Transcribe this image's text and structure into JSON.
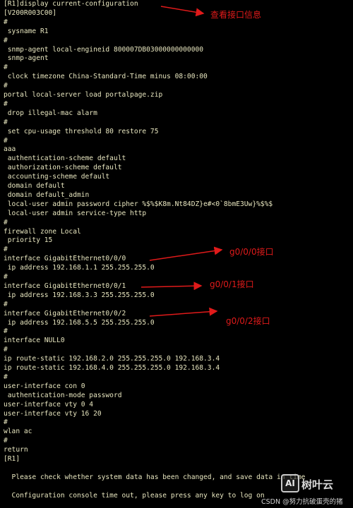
{
  "terminal": {
    "lines": [
      "[R1]display current-configuration",
      "[V200R003C00]",
      "#",
      " sysname R1",
      "#",
      " snmp-agent local-engineid 800007DB03000000000000",
      " snmp-agent",
      "#",
      " clock timezone China-Standard-Time minus 08:00:00",
      "#",
      "portal local-server load portalpage.zip",
      "#",
      " drop illegal-mac alarm",
      "#",
      " set cpu-usage threshold 80 restore 75",
      "#",
      "aaa",
      " authentication-scheme default",
      " authorization-scheme default",
      " accounting-scheme default",
      " domain default",
      " domain default_admin",
      " local-user admin password cipher %$%$K8m.Nt84DZ}e#<0`8bmE3Uw}%$%$",
      " local-user admin service-type http",
      "#",
      "firewall zone Local",
      " priority 15",
      "#",
      "interface GigabitEthernet0/0/0",
      " ip address 192.168.1.1 255.255.255.0",
      "#",
      "interface GigabitEthernet0/0/1",
      " ip address 192.168.3.3 255.255.255.0",
      "#",
      "interface GigabitEthernet0/0/2",
      " ip address 192.168.5.5 255.255.255.0",
      "#",
      "interface NULL0",
      "#",
      "ip route-static 192.168.2.0 255.255.255.0 192.168.3.4",
      "ip route-static 192.168.4.0 255.255.255.0 192.168.3.4",
      "#",
      "user-interface con 0",
      " authentication-mode password",
      "user-interface vty 0 4",
      "user-interface vty 16 20",
      "#",
      "wlan ac",
      "#",
      "return",
      "[R1]",
      "",
      "  Please check whether system data has been changed, and save data in time",
      "",
      "  Configuration console time out, please press any key to log on"
    ]
  },
  "annotations": [
    {
      "text": "查看接口信息"
    },
    {
      "text": "g0/0/0接口"
    },
    {
      "text": "g0/0/1接口"
    },
    {
      "text": "g0/0/2接口"
    }
  ],
  "watermark": {
    "logo_text": "AI",
    "site_name": "树叶云",
    "csdn_text": "CSDN @努力抗破蛋壳的猪"
  },
  "colors": {
    "background": "#000000",
    "terminal_text": "#e8e6bf",
    "annotation": "#e01a1a"
  }
}
